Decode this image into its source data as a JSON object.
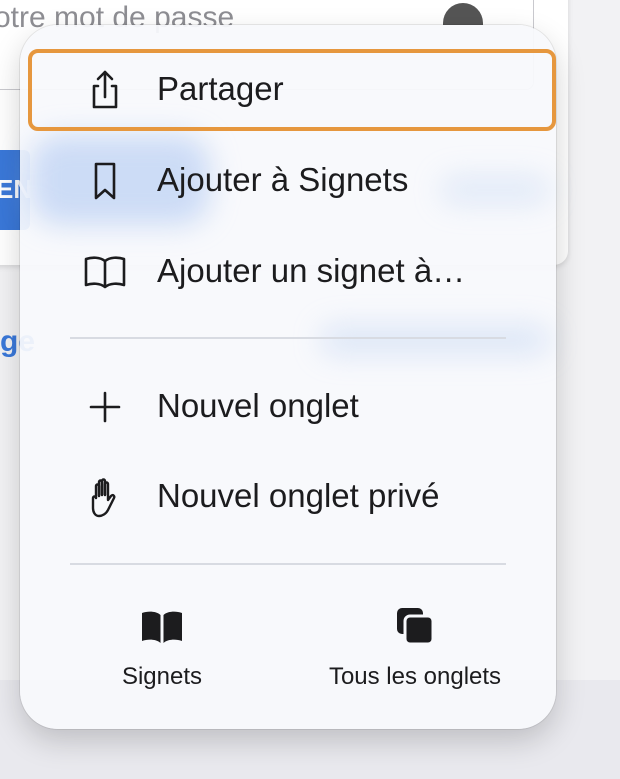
{
  "background": {
    "password_placeholder": "votre mot de passe",
    "blue_button_label": "EN",
    "link_fragment": "ge"
  },
  "menu": {
    "items": [
      {
        "label": "Partager",
        "icon": "share-icon",
        "focused": true
      },
      {
        "label": "Ajouter à Signets",
        "icon": "bookmark-icon"
      },
      {
        "label": "Ajouter un signet à…",
        "icon": "book-icon"
      },
      {
        "label": "Nouvel onglet",
        "icon": "plus-icon"
      },
      {
        "label": "Nouvel onglet privé",
        "icon": "hand-icon"
      }
    ],
    "bottom": [
      {
        "label": "Signets",
        "icon": "book-filled-icon"
      },
      {
        "label": "Tous les onglets",
        "icon": "tabs-icon"
      }
    ]
  },
  "colors": {
    "focus_ring": "#e6973e",
    "text": "#1c1c1e",
    "link_blue": "#3a78d9"
  }
}
